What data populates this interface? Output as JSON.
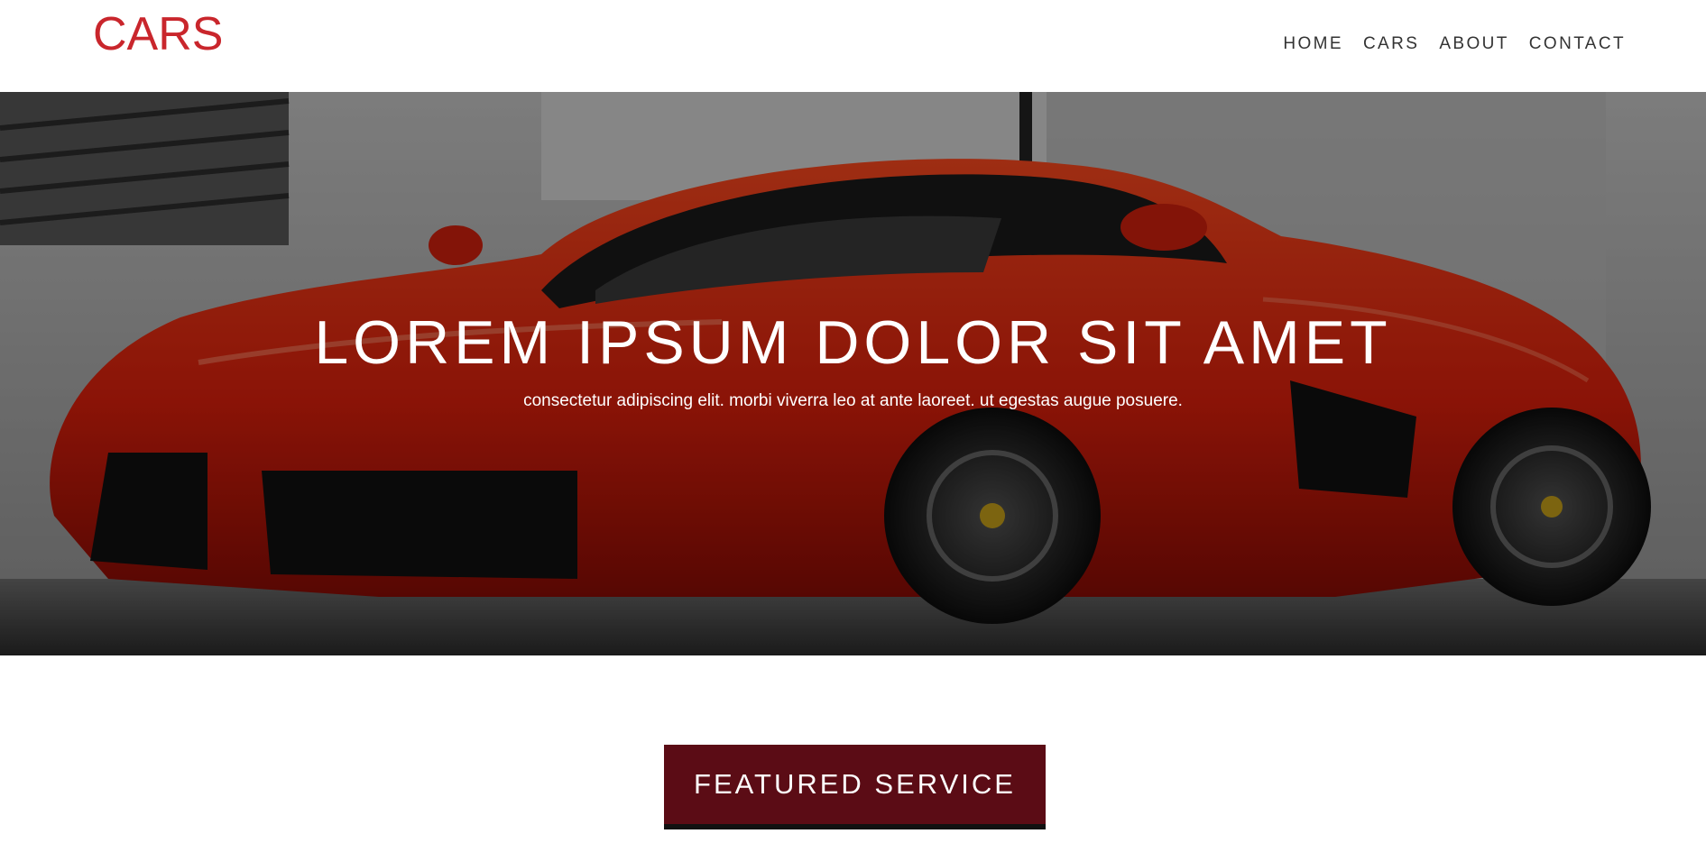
{
  "header": {
    "logo": "CARS",
    "nav": [
      "HOME",
      "CARS",
      "ABOUT",
      "CONTACT"
    ]
  },
  "hero": {
    "title": "LOREM IPSUM DOLOR SIT AMET",
    "subtitle": "consectetur adipiscing elit. morbi viverra leo at ante laoreet. ut egestas augue posuere."
  },
  "cta": {
    "label": "FEATURED SERVICE"
  },
  "colors": {
    "brand": "#c9262c",
    "button": "#5b0c15"
  }
}
